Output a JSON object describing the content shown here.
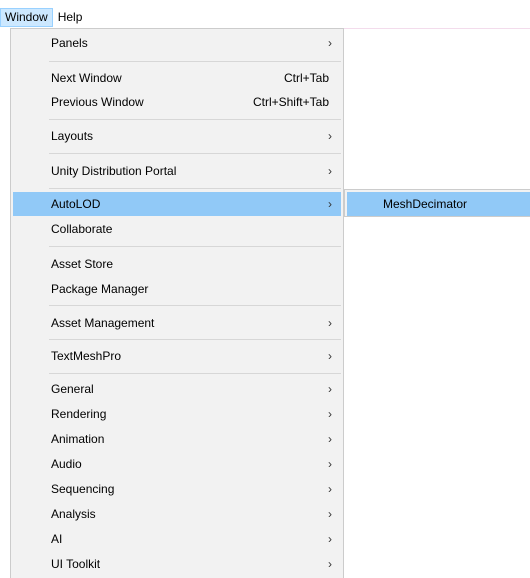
{
  "menubar": {
    "window_label": "Window",
    "help_label": "Help"
  },
  "window_menu": {
    "items": [
      {
        "label": "Panels",
        "shortcut": "",
        "submenu_arrow": "›"
      },
      {
        "label": "Next Window",
        "shortcut": "Ctrl+Tab",
        "submenu_arrow": ""
      },
      {
        "label": "Previous Window",
        "shortcut": "Ctrl+Shift+Tab",
        "submenu_arrow": ""
      },
      {
        "label": "Layouts",
        "shortcut": "",
        "submenu_arrow": "›"
      },
      {
        "label": "Unity Distribution Portal",
        "shortcut": "",
        "submenu_arrow": "›"
      },
      {
        "label": "AutoLOD",
        "shortcut": "",
        "submenu_arrow": "›"
      },
      {
        "label": "Collaborate",
        "shortcut": "",
        "submenu_arrow": ""
      },
      {
        "label": "Asset Store",
        "shortcut": "",
        "submenu_arrow": ""
      },
      {
        "label": "Package Manager",
        "shortcut": "",
        "submenu_arrow": ""
      },
      {
        "label": "Asset Management",
        "shortcut": "",
        "submenu_arrow": "›"
      },
      {
        "label": "TextMeshPro",
        "shortcut": "",
        "submenu_arrow": "›"
      },
      {
        "label": "General",
        "shortcut": "",
        "submenu_arrow": "›"
      },
      {
        "label": "Rendering",
        "shortcut": "",
        "submenu_arrow": "›"
      },
      {
        "label": "Animation",
        "shortcut": "",
        "submenu_arrow": "›"
      },
      {
        "label": "Audio",
        "shortcut": "",
        "submenu_arrow": "›"
      },
      {
        "label": "Sequencing",
        "shortcut": "",
        "submenu_arrow": "›"
      },
      {
        "label": "Analysis",
        "shortcut": "",
        "submenu_arrow": "›"
      },
      {
        "label": "AI",
        "shortcut": "",
        "submenu_arrow": "›"
      },
      {
        "label": "UI Toolkit",
        "shortcut": "",
        "submenu_arrow": "›"
      }
    ]
  },
  "autolod_submenu": {
    "items": [
      {
        "label": "MeshDecimator"
      }
    ]
  },
  "colors": {
    "highlight": "#91c9f7",
    "menu_background": "#f2f2f2",
    "menubar_active": "#cce8ff"
  }
}
